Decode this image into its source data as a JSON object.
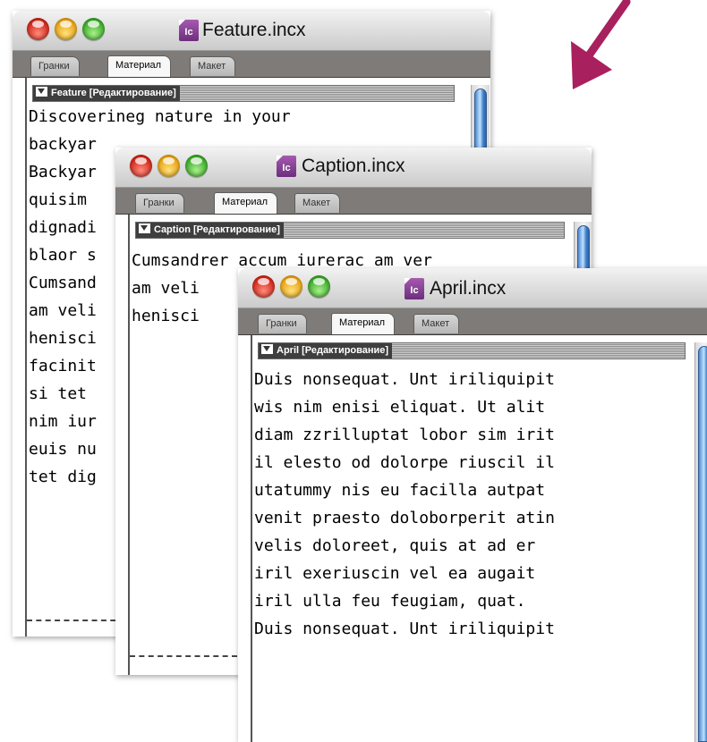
{
  "windows": {
    "feature": {
      "title": "Feature.incx",
      "icon_label": "Ic",
      "tabs": [
        "Гранки",
        "Материал",
        "Макет"
      ],
      "active_tab": "Материал",
      "header": "Feature [Редактирование]",
      "lines": [
        "Discoverineg nature in your",
        "backyar",
        "Backyar",
        "quisim",
        "dignadi",
        "blaor s",
        "Cumsand",
        "am veli",
        "henisci",
        "facinit",
        "si tet",
        "nim iur",
        "euis nu",
        "tet dig"
      ]
    },
    "caption": {
      "title": "Caption.incx",
      "icon_label": "Ic",
      "tabs": [
        "Гранки",
        "Материал",
        "Макет"
      ],
      "active_tab": "Материал",
      "header": "Caption [Редактирование]",
      "lines": [
        "Cumsandrer accum iurerac am ver",
        "am veli",
        "henisci"
      ]
    },
    "april": {
      "title": "April.incx",
      "icon_label": "Ic",
      "tabs": [
        "Гранки",
        "Материал",
        "Макет"
      ],
      "active_tab": "Материал",
      "header": "April [Редактирование]",
      "lines": [
        "Duis nonsequat. Unt iriliquipit",
        "wis nim enisi eliquat. Ut alit",
        "diam zzrilluptat lobor sim irit",
        "il elesto od dolorpe riuscil il",
        "utatummy nis eu facilla autpat",
        "venit praesto doloborperit atin",
        "velis doloreet, quis at ad er",
        "iril exeriuscin vel ea augait",
        "iril ulla feu feugiam, quat.",
        "Duis nonsequat. Unt iriliquipit"
      ]
    }
  },
  "colors": {
    "arrow": "#a8205e",
    "icon": "#7a3088",
    "scroll_thumb": "#4f88cc"
  }
}
